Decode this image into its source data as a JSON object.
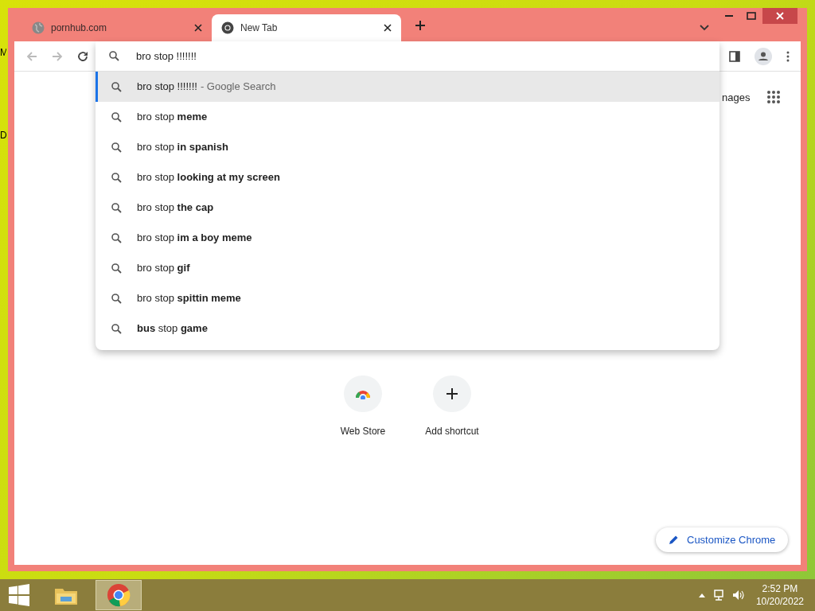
{
  "desktop_labels": [
    "M",
    "D"
  ],
  "tabs": [
    {
      "title": "pornhub.com",
      "kind": "globe",
      "selected": false
    },
    {
      "title": "New Tab",
      "kind": "chrome",
      "selected": true
    }
  ],
  "omnibox": {
    "value": "bro stop !!!!!!!"
  },
  "suggestions": [
    {
      "text": "bro stop !!!!!!!",
      "hint": "- Google Search",
      "selected": true
    },
    {
      "text": "bro stop **meme**",
      "selected": false
    },
    {
      "text": "bro stop **in spanish**",
      "selected": false
    },
    {
      "text": "bro stop **looking at my screen**",
      "selected": false
    },
    {
      "text": "bro stop **the cap**",
      "selected": false
    },
    {
      "text": "bro stop **im a boy meme**",
      "selected": false
    },
    {
      "text": "bro stop **gif**",
      "selected": false
    },
    {
      "text": "bro stop **spittin meme**",
      "selected": false
    },
    {
      "text": "**bus** stop **game**",
      "selected": false
    }
  ],
  "header_link": "nages",
  "shortcuts": [
    {
      "label": "Web Store",
      "kind": "store"
    },
    {
      "label": "Add shortcut",
      "kind": "add"
    }
  ],
  "customize_button": "Customize Chrome",
  "taskbar": {
    "apps": [
      {
        "kind": "explorer",
        "selected": false
      },
      {
        "kind": "chrome",
        "selected": true
      }
    ],
    "time": "2:52 PM",
    "date": "10/20/2022"
  }
}
